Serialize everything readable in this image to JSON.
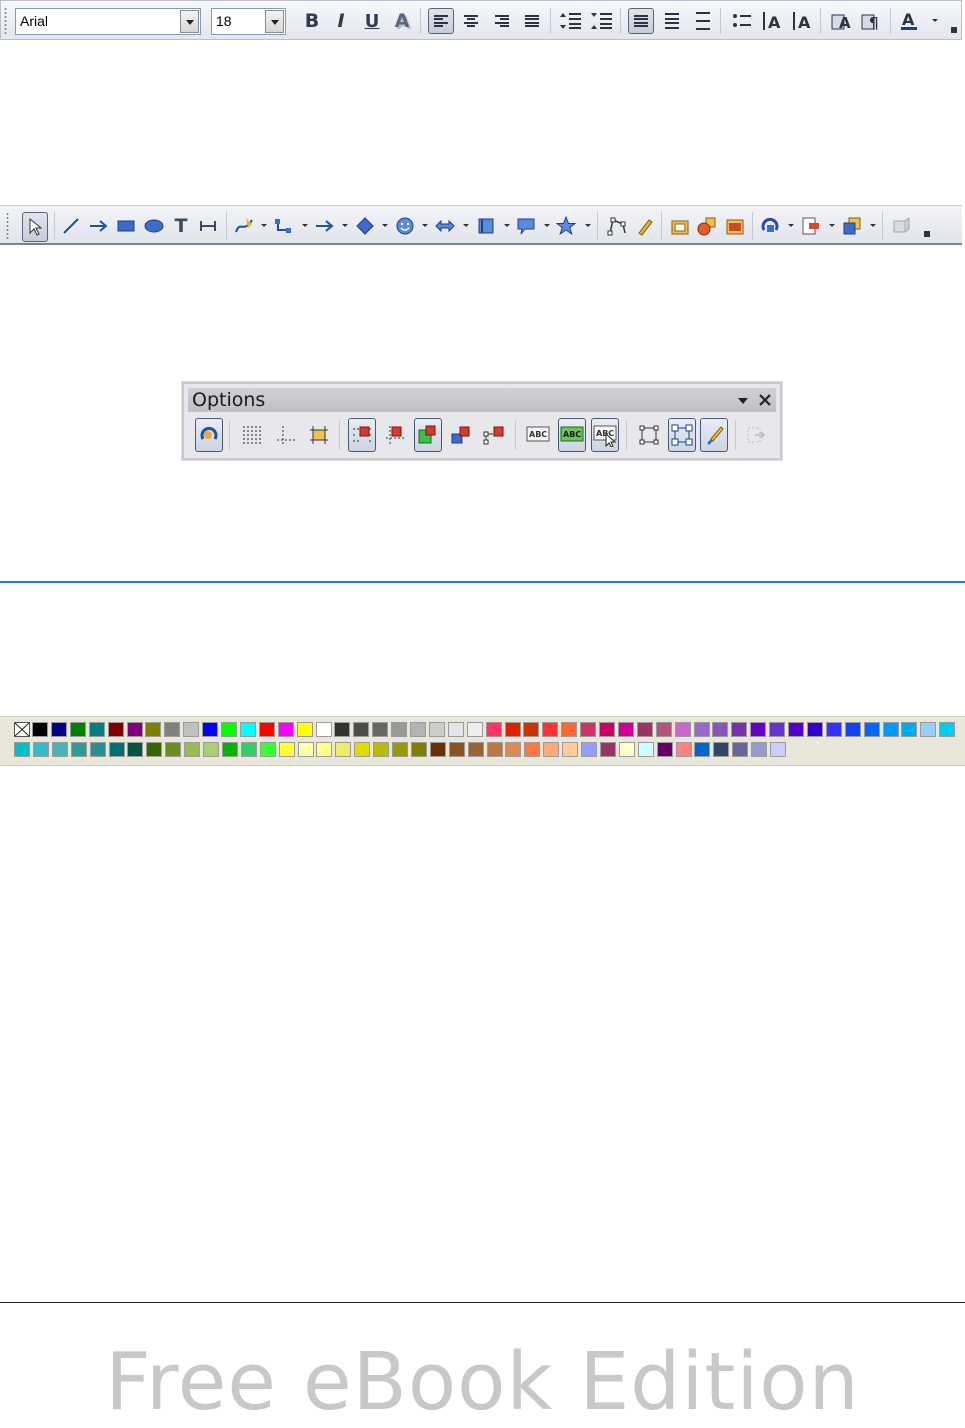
{
  "formatting_toolbar": {
    "font_name": "Arial",
    "font_size": "18",
    "bold": "B",
    "italic": "I",
    "underline": "U",
    "shadow": "A"
  },
  "drawing_toolbar": {
    "text_tool": "T"
  },
  "options_toolbar": {
    "title": "Options",
    "text_frame_label": "ABC"
  },
  "color_bar": {
    "row1": [
      "#000000",
      "#000080",
      "#008000",
      "#008080",
      "#800000",
      "#800080",
      "#808000",
      "#808080",
      "#c0c0c0",
      "#0000ff",
      "#00ff00",
      "#00ffff",
      "#ff0000",
      "#ff00ff",
      "#ffff00",
      "#ffffff",
      "#333333",
      "#4c4c4c",
      "#666666",
      "#999999",
      "#b3b3b3",
      "#cccccc",
      "#e6e6e6",
      "#eeeeee",
      "#ff3366",
      "#dc2300",
      "#cc3300",
      "#ff3333",
      "#ff6633",
      "#cc3366",
      "#cc0066",
      "#cc0099",
      "#993366",
      "#b3557a",
      "#cc66cc",
      "#9966cc",
      "#8855bb",
      "#7733aa",
      "#6600cc",
      "#6633cc",
      "#5500cc",
      "#3300cc",
      "#3333ff",
      "#1144ee",
      "#0066ff",
      "#0099ff",
      "#00aaee",
      "#99ccff",
      "#00ccee"
    ],
    "row2": [
      "#00c0c8",
      "#33bbcc",
      "#44b6b6",
      "#339999",
      "#2a8f8f",
      "#007070",
      "#005544",
      "#336600",
      "#6b8e23",
      "#99bb55",
      "#a8d070",
      "#00b400",
      "#33cc66",
      "#33ff33",
      "#ffff33",
      "#ffffaa",
      "#ffff88",
      "#eeee66",
      "#dddd00",
      "#bbbb00",
      "#999900",
      "#808000",
      "#663300",
      "#885522",
      "#996633",
      "#bb7744",
      "#dd8855",
      "#ff7744",
      "#ffaa77",
      "#ffcc99",
      "#9999ff",
      "#993366",
      "#ffffcc",
      "#ccffff",
      "#660066",
      "#ff8080",
      "#0066cc",
      "#334466",
      "#666699",
      "#9999cc",
      "#ccccff"
    ]
  },
  "footer": {
    "watermark": "Free eBook Edition"
  }
}
